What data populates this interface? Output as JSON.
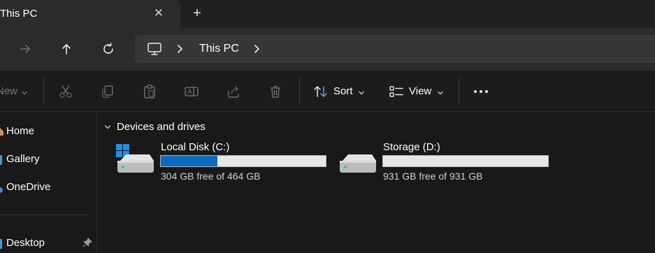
{
  "tab": {
    "title": "This PC",
    "close_glyph": "✕",
    "new_tab_glyph": "+"
  },
  "nav": {
    "forward_icon": "arrow-right-icon",
    "up_icon": "arrow-up-icon",
    "refresh_icon": "refresh-icon",
    "breadcrumb": [
      "This PC"
    ]
  },
  "toolbar": {
    "new_label": "New",
    "sort_label": "Sort",
    "view_label": "View",
    "icons": [
      "cut-icon",
      "copy-icon",
      "paste-icon",
      "rename-icon",
      "share-icon",
      "delete-icon",
      "sort-icon",
      "view-icon",
      "more-icon"
    ]
  },
  "sidebar": {
    "items": [
      {
        "label": "Home",
        "icon": "home-icon"
      },
      {
        "label": "Gallery",
        "icon": "gallery-icon"
      },
      {
        "label": "OneDrive",
        "icon": "onedrive-icon"
      },
      {
        "label": "Desktop",
        "icon": "pin-icon"
      }
    ]
  },
  "main": {
    "group_label": "Devices and drives",
    "drives": [
      {
        "name": "Local Disk (C:)",
        "free_text": "304 GB free of 464 GB",
        "used_fraction": 0.345,
        "icon": "windows-drive-icon"
      },
      {
        "name": "Storage (D:)",
        "free_text": "931 GB free of 931 GB",
        "used_fraction": 0.0,
        "icon": "drive-icon"
      }
    ]
  },
  "colors": {
    "accent": "#0f6cbd",
    "background": "#191919",
    "navbar": "#2b2b2b",
    "address": "#373737"
  }
}
